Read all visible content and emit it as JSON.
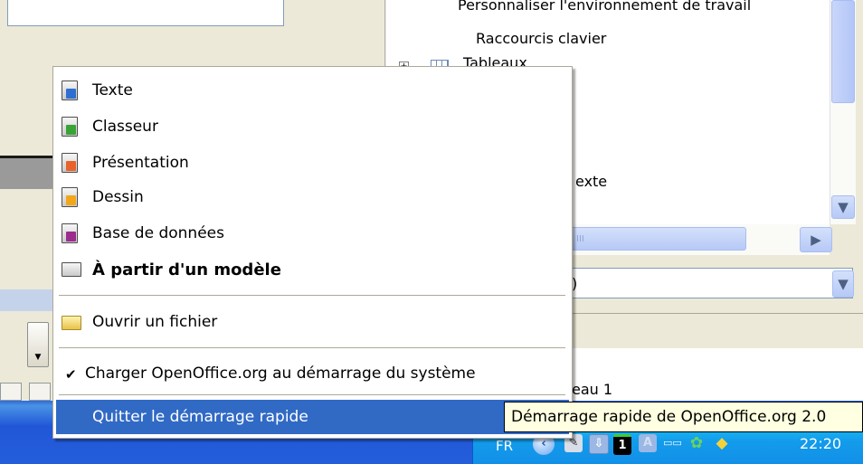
{
  "tree": {
    "items": [
      {
        "label": "Personnaliser l'environnement de travail"
      },
      {
        "label": "Raccourcis clavier"
      },
      {
        "label": "Tableaux"
      },
      {
        "label": "exte"
      }
    ]
  },
  "combo": {
    "value": ")"
  },
  "right_lower": {
    "label": "eau 1"
  },
  "menu": {
    "items": [
      {
        "label": "Texte",
        "icon": "writer-icon",
        "color": "#2f6fd1"
      },
      {
        "label": "Classeur",
        "icon": "calc-icon",
        "color": "#3aa335"
      },
      {
        "label": "Présentation",
        "icon": "impress-icon",
        "color": "#e8622a"
      },
      {
        "label": "Dessin",
        "icon": "draw-icon",
        "color": "#f2a71a"
      },
      {
        "label": "Base de données",
        "icon": "base-icon",
        "color": "#9b2d8c"
      },
      {
        "label": "À partir d'un modèle",
        "icon": "template-icon"
      },
      {
        "label": "Ouvrir un fichier",
        "icon": "folder-open-icon"
      },
      {
        "label": "Charger OpenOffice.org au démarrage du système",
        "checked": true
      },
      {
        "label": "Quitter le démarrage rapide",
        "highlighted": true
      }
    ]
  },
  "tooltip": {
    "text": "Démarrage rapide de OpenOffice.org 2.0"
  },
  "tray": {
    "language": "FR",
    "workspace": "1",
    "keyboard": "A",
    "clock": "22:20"
  },
  "colors": {
    "taskbar": "#245edb",
    "highlight": "#316ac5",
    "tooltip_bg": "#ffffe1"
  }
}
